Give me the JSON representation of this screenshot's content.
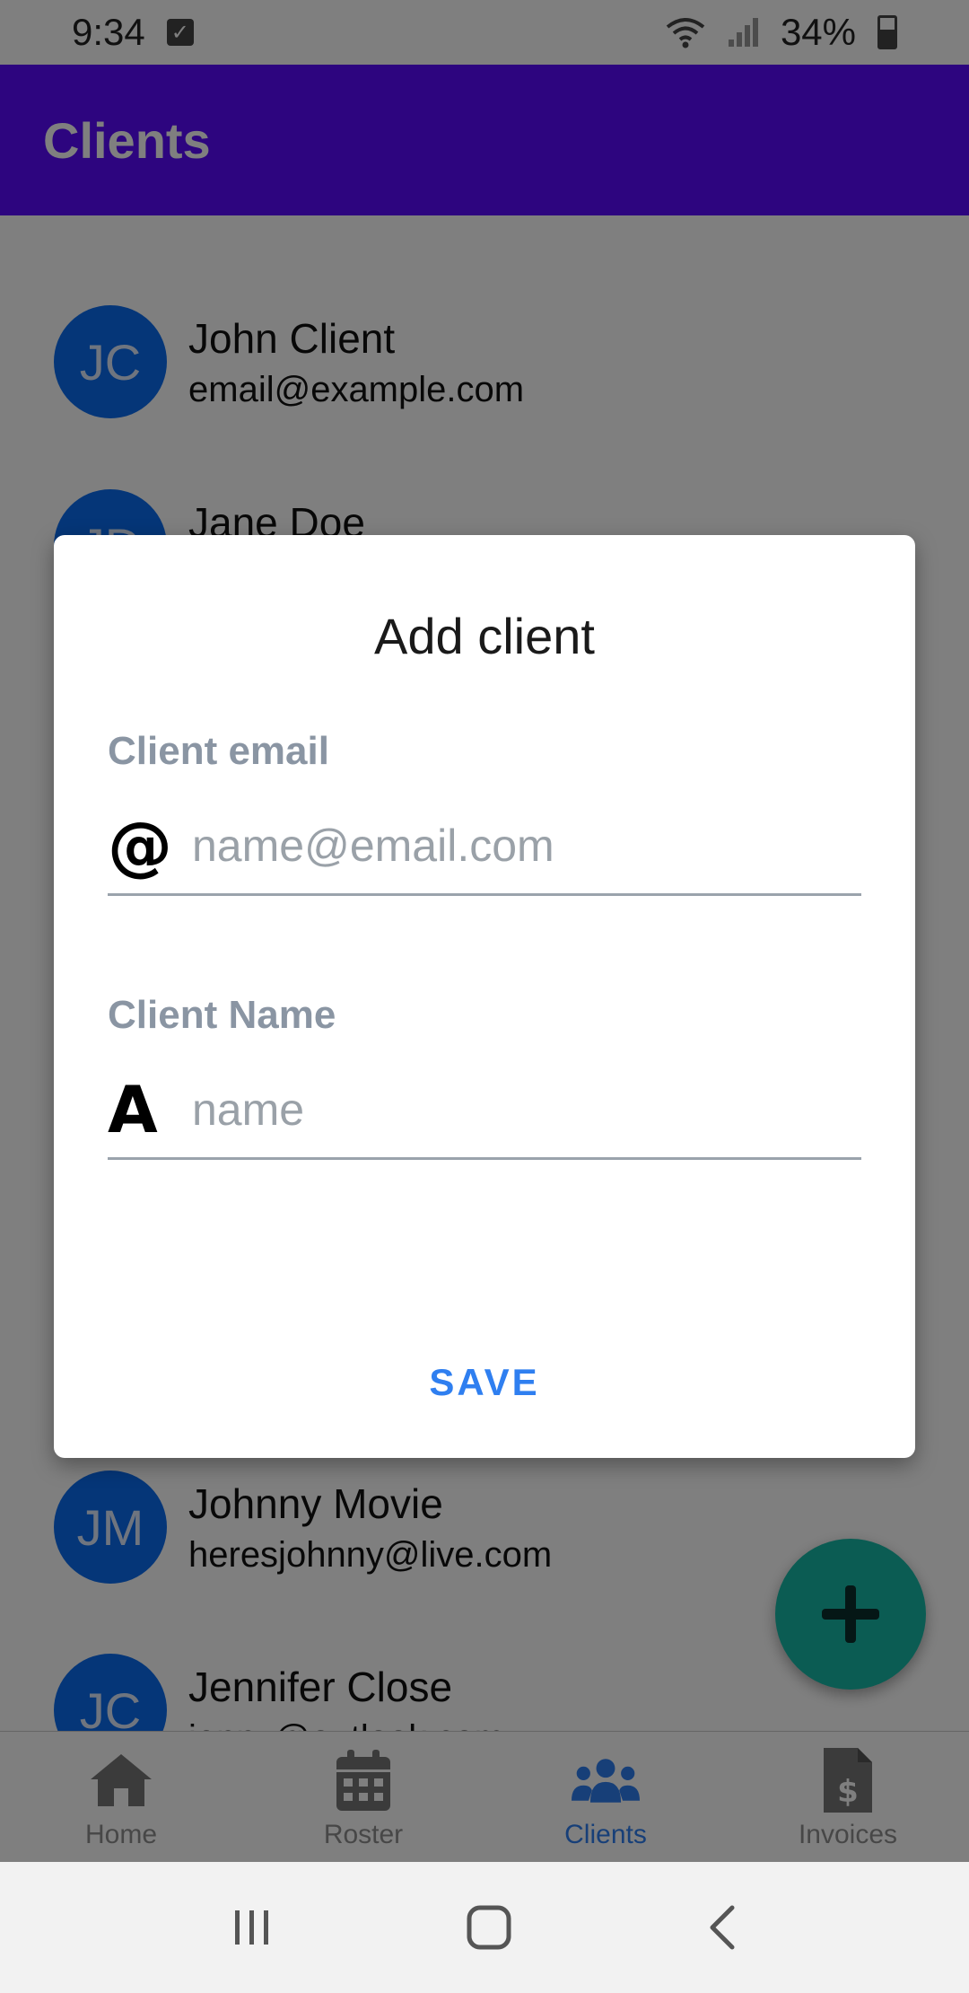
{
  "status_bar": {
    "time": "9:34",
    "battery": "34%"
  },
  "app_bar": {
    "title": "Clients"
  },
  "clients": [
    {
      "initials": "JC",
      "name": "John Client",
      "email": "email@example.com"
    },
    {
      "initials": "JD",
      "name": "Jane Doe",
      "email": ""
    },
    {
      "initials": "JM",
      "name": "Johnny Movie",
      "email": "heresjohnny@live.com"
    },
    {
      "initials": "JC",
      "name": "Jennifer Close",
      "email": "jenny@outlook.com"
    }
  ],
  "bottom_nav": [
    {
      "label": "Home",
      "icon": "home-icon"
    },
    {
      "label": "Roster",
      "icon": "calendar-icon"
    },
    {
      "label": "Clients",
      "icon": "users-icon",
      "active": true
    },
    {
      "label": "Invoices",
      "icon": "invoice-icon"
    }
  ],
  "dialog": {
    "title": "Add client",
    "email_label": "Client email",
    "email_placeholder": "name@email.com",
    "email_icon": "@",
    "name_label": "Client Name",
    "name_placeholder": "name",
    "name_icon": "A",
    "save_label": "SAVE"
  },
  "colors": {
    "app_bar": "#5a0bff",
    "avatar": "#0b6cf0",
    "fab": "#16b8a6",
    "accent": "#2f7ff0"
  }
}
